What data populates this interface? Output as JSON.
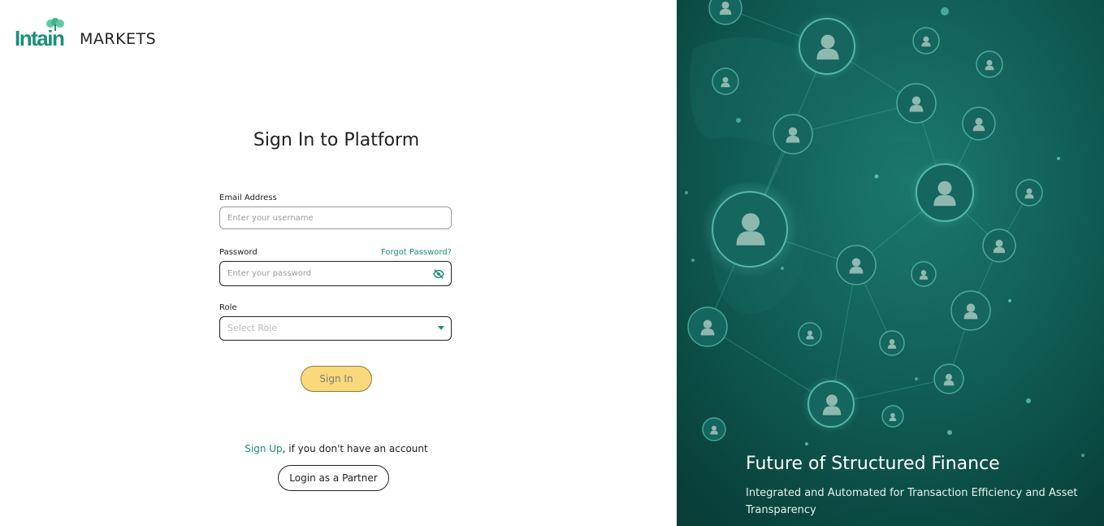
{
  "brand": {
    "logo_main": "Intain",
    "logo_suffix": "MARKETS",
    "primary_color": "#1a8f7a",
    "accent_color": "#f9d97a",
    "panel_color": "#0c4f49"
  },
  "form": {
    "title": "Sign In to Platform",
    "email": {
      "label": "Email Address",
      "placeholder": "Enter your username",
      "value": ""
    },
    "password": {
      "label": "Password",
      "placeholder": "Enter your password",
      "value": "",
      "forgot_label": "Forgot Password?",
      "toggle_icon": "eye-slash-icon"
    },
    "role": {
      "label": "Role",
      "placeholder": "Select Role",
      "icon": "caret-down-icon"
    },
    "submit_label": "Sign In"
  },
  "signup": {
    "link_label": "Sign Up",
    "rest_text": ", if you don't have an account"
  },
  "partner_button_label": "Login as a Partner",
  "hero": {
    "title": "Future of Structured Finance",
    "subtitle": "Integrated and Automated for Transaction Efficiency and Asset Transparency"
  }
}
